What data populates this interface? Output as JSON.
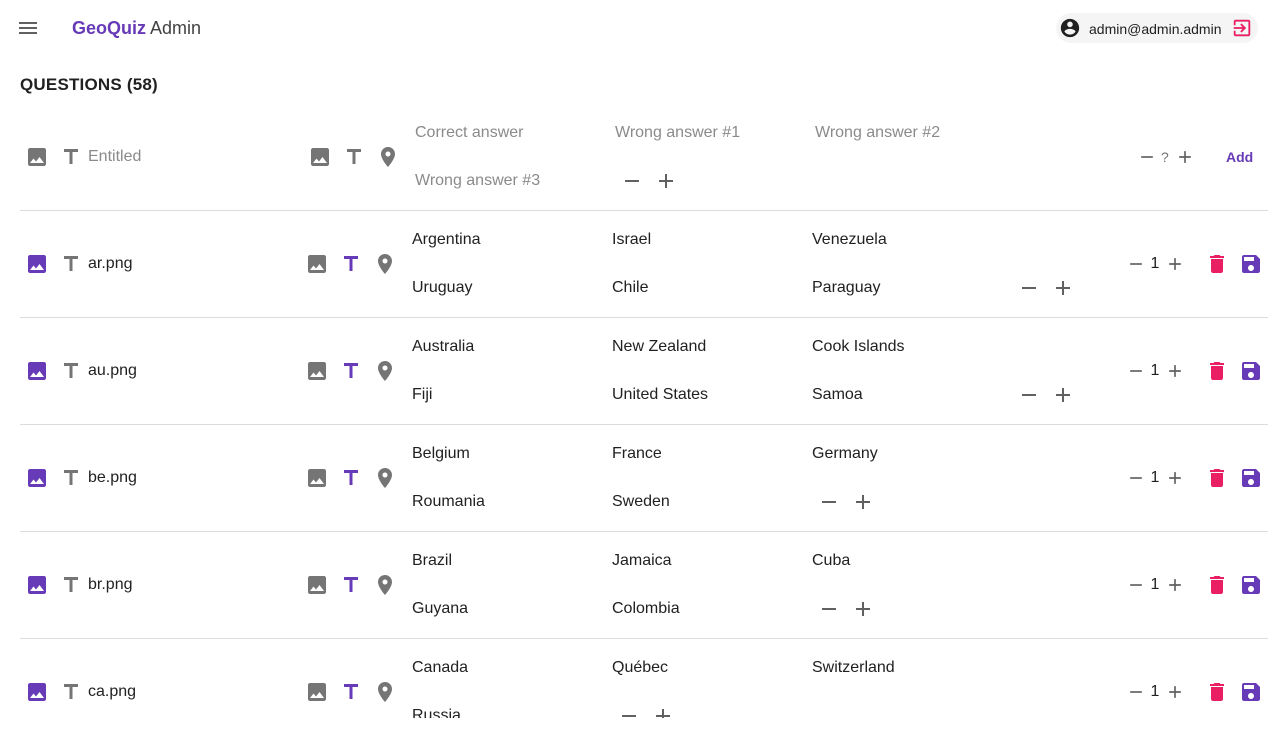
{
  "app": {
    "brand_name": "GeoQuiz",
    "brand_suffix": "Admin"
  },
  "user": {
    "email": "admin@admin.admin",
    "icon": "account-circle-icon",
    "logout_icon": "logout-icon"
  },
  "page": {
    "title": "QUESTIONS (58)"
  },
  "colors": {
    "accent": "#673ab7",
    "danger": "#e91e63",
    "icon_grey": "#757575",
    "divider": "#dcdcdc"
  },
  "new_question": {
    "entitled_placeholder": "Entitled",
    "answer_placeholders": [
      "Correct answer",
      "Wrong answer #1",
      "Wrong answer #2",
      "Wrong answer #3"
    ],
    "level": "?",
    "add_label": "Add"
  },
  "questions": [
    {
      "entitled": "ar.png",
      "answers": [
        "Argentina",
        "Israel",
        "Venezuela",
        "Uruguay",
        "Chile",
        "Paraguay"
      ],
      "level": "1"
    },
    {
      "entitled": "au.png",
      "answers": [
        "Australia",
        "New Zealand",
        "Cook Islands",
        "Fiji",
        "United States",
        "Samoa"
      ],
      "level": "1"
    },
    {
      "entitled": "be.png",
      "answers": [
        "Belgium",
        "France",
        "Germany",
        "Roumania",
        "Sweden"
      ],
      "level": "1"
    },
    {
      "entitled": "br.png",
      "answers": [
        "Brazil",
        "Jamaica",
        "Cuba",
        "Guyana",
        "Colombia"
      ],
      "level": "1"
    },
    {
      "entitled": "ca.png",
      "answers": [
        "Canada",
        "Québec",
        "Switzerland",
        "Russia"
      ],
      "level": "1"
    }
  ]
}
